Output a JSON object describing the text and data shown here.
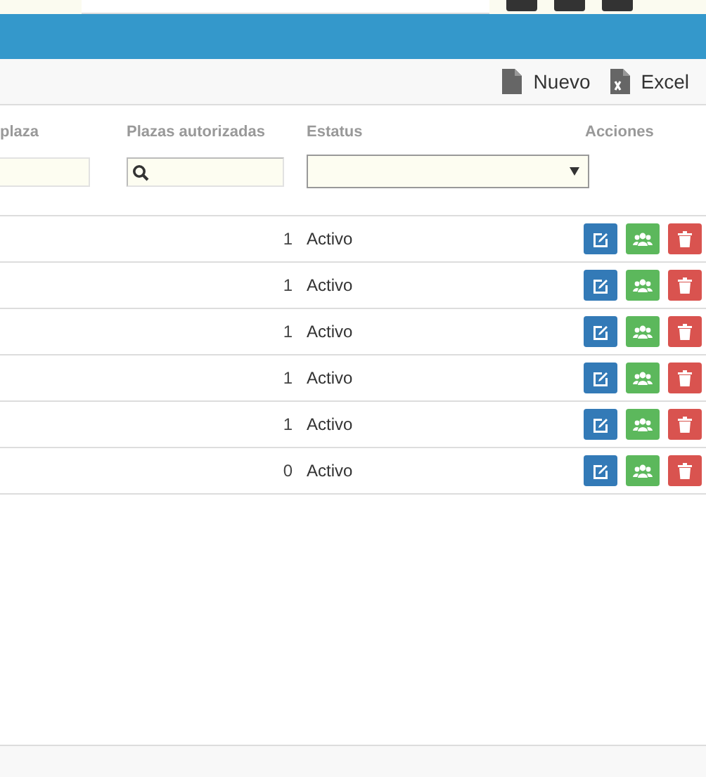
{
  "toolbar": {
    "buttons": [
      {
        "kind": "new",
        "label": "Nuevo"
      },
      {
        "kind": "excel",
        "label": "Excel"
      }
    ]
  },
  "table": {
    "columns": [
      "plaza",
      "Plazas autorizadas",
      "Estatus",
      "Acciones"
    ],
    "filters": [
      {
        "kind": "text"
      },
      {
        "kind": "search"
      },
      {
        "kind": "select"
      }
    ],
    "rows": [
      {
        "plazas_autorizadas": "1",
        "estatus": "Activo"
      },
      {
        "plazas_autorizadas": "1",
        "estatus": "Activo"
      },
      {
        "plazas_autorizadas": "1",
        "estatus": "Activo"
      },
      {
        "plazas_autorizadas": "1",
        "estatus": "Activo"
      },
      {
        "plazas_autorizadas": "1",
        "estatus": "Activo"
      },
      {
        "plazas_autorizadas": "0",
        "estatus": "Activo"
      }
    ]
  }
}
